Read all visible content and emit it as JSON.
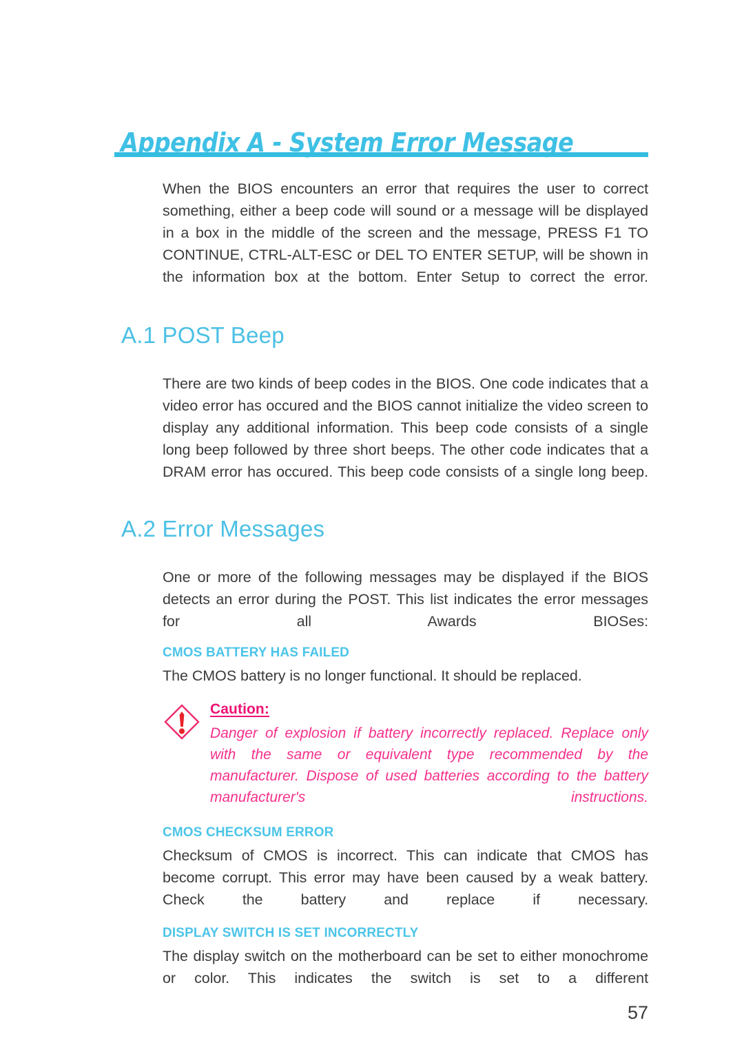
{
  "document": {
    "appendix_title": "Appendix A - System Error Message",
    "page_number": "57"
  },
  "intro": {
    "paragraph": "When the BIOS encounters an error that requires the user to correct something, either a beep code will sound or a message will be displayed in a box in the middle of the screen and the message, PRESS F1 TO CONTINUE, CTRL-ALT-ESC or DEL TO ENTER SETUP, will be shown in the information box at the bottom. Enter Setup to correct the error."
  },
  "sections": [
    {
      "heading": "A.1 POST Beep",
      "paragraph": "There are two kinds of beep codes in the BIOS. One code indicates that a video error has occured and the BIOS cannot initialize the video screen to display any additional information. This beep code consists of a single long beep followed by three short beeps. The other code indicates that a DRAM error has occured. This beep code consists of a single long beep."
    },
    {
      "heading": "A.2 Error Messages",
      "paragraph": "One or more of the following messages may be displayed if the BIOS detects an error during the POST. This list indicates the error messages for all Awards BIOSes:"
    }
  ],
  "error_messages": [
    {
      "title": "CMOS BATTERY HAS FAILED",
      "description": "The CMOS battery is no longer functional. It should be replaced."
    },
    {
      "title": "CMOS CHECKSUM ERROR",
      "description": "Checksum of CMOS is incorrect. This can indicate that CMOS has become corrupt. This error may have been caused by a weak battery. Check the battery and replace if necessary."
    },
    {
      "title": "DISPLAY SWITCH IS SET INCORRECTLY",
      "description": "The display switch on the motherboard can be set to either monochrome or color. This indicates the switch is set to a different"
    }
  ],
  "caution": {
    "label": "Caution:",
    "text": "Danger of explosion if battery incorrectly replaced. Replace only with the same or equivalent type recommended by the manufacturer. Dispose of used batteries according to the battery manufacturer's instructions.",
    "icon": "caution-diamond-icon"
  },
  "colors": {
    "heading_cyan": "#4bc0e4",
    "rule_cyan": "#35bde0",
    "subheading_cyan": "#4bc4e8",
    "caution_label_pink": "#ed1274",
    "caution_text_pink": "#f5308c",
    "body_text": "#3a3a3a"
  }
}
